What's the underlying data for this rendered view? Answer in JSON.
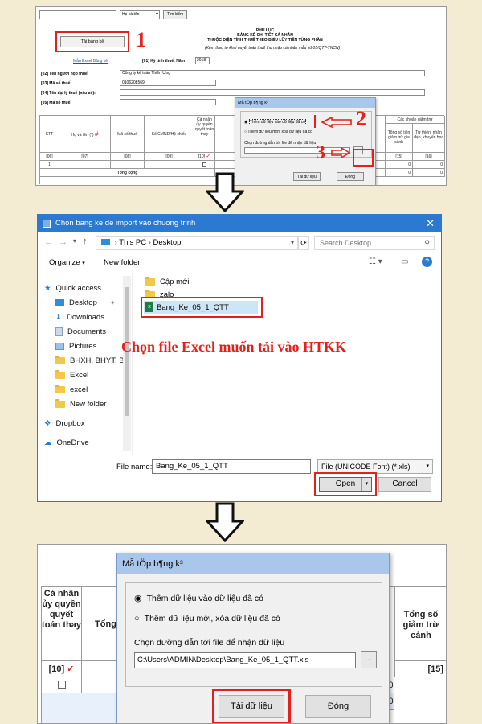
{
  "panel1": {
    "search_select": "Họ và tên",
    "search_button": "Tìm kiếm",
    "upload_button": "Tải bảng kê",
    "form_title_1": "PHỤ LỤC",
    "form_title_2": "BẢNG KÊ CHI TIẾT CÁ NHÂN",
    "form_title_3": "THUỘC DIỆN TÍNH THUẾ THEO BIỂU LŨY TIẾN TỪNG PHẦN",
    "form_subtitle": "(Kèm theo tờ khai quyết toán thuế thu nhập cá nhân mẫu số 05/QTT-TNCN)",
    "sample_link": "Mẫu Excel Bảng kê",
    "period_label": "[01] Kỳ tính thuế: Năm",
    "period_value": "2018",
    "taxpayer_label": "[02] Tên người nộp thuế:",
    "taxpayer_value": "Công ty kế toán Thiên Ưng",
    "taxcode_label": "[03] Mã số thuế:",
    "taxcode_value": "0106208569",
    "agent_label": "[04] Tên đại lý thuế (nếu có):",
    "agent_taxcode_label": "[05] Mã số thuế:",
    "table": {
      "headers": [
        "STT",
        "Họ và tên (*)",
        "Mã số thuế",
        "Số CMND/Hộ chiếu",
        "Cá nhân ủy quyền quyết toán thay",
        "Tổng số tiền giảm trừ gia cảnh",
        "Từ thiện, nhân đạo, khuyến học"
      ],
      "codes": [
        "[06]",
        "[07]",
        "[08]",
        "[09]",
        "[10]",
        "[15]",
        "[16]"
      ],
      "row_stt": "1",
      "total_label": "Tổng cộng",
      "zero": "0",
      "group_header": "Các khoản giảm trừ"
    },
    "dialog": {
      "title": "Mẫ tÖp b¶ng k³",
      "option1": "Thêm dữ liệu vào dữ liệu đã có",
      "option2": "Thêm dữ liệu mới, xóa dữ liệu đã có",
      "path_label": "Chọn đường dẫn tới file để nhận dữ liệu",
      "load_button": "Tải dữ liệu",
      "close_button": "Đóng"
    },
    "step1": "1",
    "step2": "2",
    "step3": "3"
  },
  "panel2": {
    "title": "Chon bang ke de import vao chuong trinh",
    "path_thispc": "This PC",
    "path_desktop": "Desktop",
    "search_placeholder": "Search Desktop",
    "organize": "Organize",
    "new_folder": "New folder",
    "nav_items": [
      "Quick access",
      "Desktop",
      "Downloads",
      "Documents",
      "Pictures",
      "BHXH, BHYT, BH",
      "Excel",
      "excel",
      "New folder",
      "Dropbox",
      "OneDrive"
    ],
    "files": [
      "Cập mới",
      "zalo",
      "Bang_Ke_05_1_QTT"
    ],
    "annotation": "Chọn file Excel muốn tải vào HTKK",
    "filename_label": "File name:",
    "filename_value": "Bang_Ke_05_1_QTT",
    "filetype": "File (UNICODE Font) (*.xls)",
    "open_button": "Open",
    "cancel_button": "Cancel"
  },
  "panel3": {
    "dialog_title": "Mẫ tÖp b¶ng k³",
    "option1": "Thêm dữ liệu vào dữ liệu đã có",
    "option2": "Thêm dữ liệu mới, xóa dữ liệu đã có",
    "path_label": "Chọn đường dẫn tới file để nhận dữ liệu",
    "path_value": "C:\\Users\\ADMIN\\Desktop\\Bang_Ke_05_1_QTT.xls",
    "browse": "...",
    "load_button": "Tải dữ liệu",
    "close_button": "Đóng",
    "col_individual": "Cá nhân ủy quyền quyết toán thay",
    "col_tong": "Tổng",
    "col_deduction": "Tổng số giảm trừ cảnh",
    "code_10": "[10]",
    "code_15": "[15]",
    "zero": "0"
  },
  "colors": {
    "accent_red": "#e3201b",
    "win_blue": "#0078d7",
    "legacy_title": "#a9c7ea"
  }
}
